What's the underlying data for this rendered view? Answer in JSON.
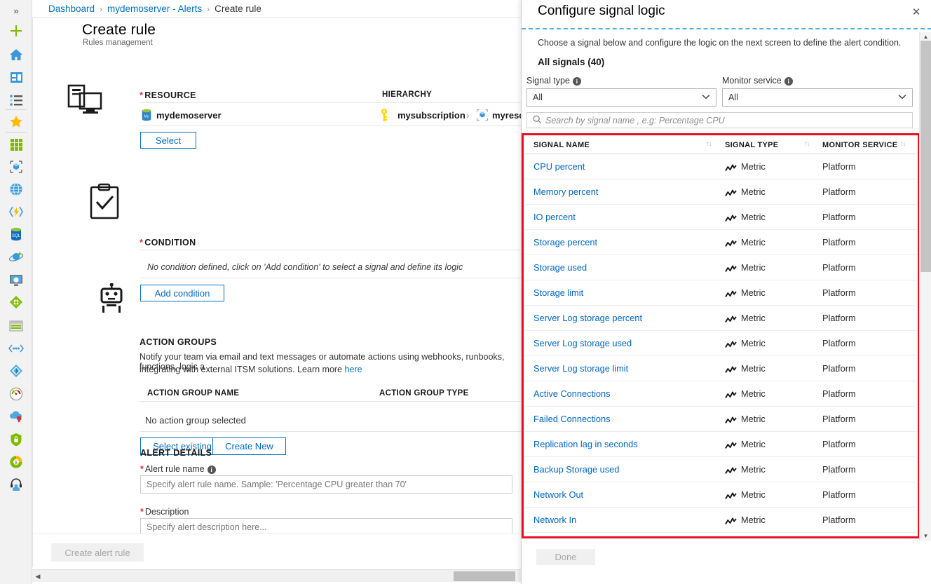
{
  "nav": {
    "collapse_label": "»",
    "items": [
      {
        "name": "create-resource-icon",
        "label": "Create a resource"
      },
      {
        "name": "home-icon",
        "label": "Home"
      },
      {
        "name": "dashboard-icon",
        "label": "Dashboard"
      },
      {
        "name": "all-services-icon",
        "label": "All services"
      },
      {
        "name": "favorites-star-icon",
        "label": "Favorites"
      },
      {
        "name": "all-resources-grid-icon",
        "label": "All resources"
      },
      {
        "name": "resource-groups-icon",
        "label": "Resource groups"
      },
      {
        "name": "app-services-icon",
        "label": "App Services"
      },
      {
        "name": "function-apps-icon",
        "label": "Function Apps"
      },
      {
        "name": "sql-databases-icon",
        "label": "SQL databases"
      },
      {
        "name": "azure-cosmos-db-icon",
        "label": "Azure Cosmos DB"
      },
      {
        "name": "virtual-machines-icon",
        "label": "Virtual machines"
      },
      {
        "name": "load-balancers-icon",
        "label": "Load balancers"
      },
      {
        "name": "storage-accounts-icon",
        "label": "Storage accounts"
      },
      {
        "name": "virtual-networks-icon",
        "label": "Virtual networks"
      },
      {
        "name": "azure-active-directory-icon",
        "label": "Azure Active Directory"
      },
      {
        "name": "monitor-icon",
        "label": "Monitor"
      },
      {
        "name": "advisor-icon",
        "label": "Advisor"
      },
      {
        "name": "security-center-icon",
        "label": "Security Center"
      },
      {
        "name": "cost-management-icon",
        "label": "Cost Management + Billing"
      },
      {
        "name": "help-and-support-icon",
        "label": "Help + support"
      }
    ]
  },
  "breadcrumb": {
    "items": [
      "Dashboard",
      "mydemoserver - Alerts",
      "Create rule"
    ],
    "separator": "›"
  },
  "blade": {
    "title": "Create rule",
    "subtitle": "Rules management",
    "resource": {
      "section_title": "RESOURCE",
      "required_mark": "*",
      "hierarchy_header": "HIERARCHY",
      "resource_name": "mydemoserver",
      "hierarchy": [
        "mysubscription",
        "myresourcegr"
      ],
      "hierarchy_sep": "›",
      "select_button": "Select"
    },
    "condition": {
      "section_title": "CONDITION",
      "required_mark": "*",
      "empty_text": "No condition defined, click on 'Add condition' to select a signal and define its logic",
      "add_button": "Add condition"
    },
    "action_groups": {
      "section_title": "ACTION GROUPS",
      "description_line1": "Notify your team via email and text messages or automate actions using webhooks, runbooks, functions, logic a",
      "description_line2": "integrating with external ITSM solutions. Learn more ",
      "learn_more_link": "here",
      "col_name": "ACTION GROUP NAME",
      "col_type": "ACTION GROUP TYPE",
      "empty_text": "No action group selected",
      "select_existing_button": "Select existing",
      "create_new_button": "Create New"
    },
    "alert_details": {
      "section_title": "ALERT DETAILS",
      "rule_name_label": "Alert rule name",
      "rule_name_required": "*",
      "rule_name_placeholder": "Specify alert rule name. Sample: 'Percentage CPU greater than 70'",
      "rule_name_value": "",
      "description_label": "Description",
      "description_required": "*",
      "description_placeholder": "Specify alert description here...",
      "description_value": ""
    },
    "footer": {
      "create_button": "Create alert rule"
    }
  },
  "panel": {
    "title": "Configure signal logic",
    "close_label": "✕",
    "description": "Choose a signal below and configure the logic on the next screen to define the alert condition.",
    "all_signals": "All signals (40)",
    "signal_type": {
      "label": "Signal type",
      "value": "All",
      "chevron": "⌄"
    },
    "monitor_service": {
      "label": "Monitor service",
      "value": "All",
      "chevron": "⌄"
    },
    "search": {
      "placeholder": "Search by signal name , e.g: Percentage CPU",
      "value": ""
    },
    "table": {
      "columns": [
        "SIGNAL NAME",
        "SIGNAL TYPE",
        "MONITOR SERVICE"
      ],
      "sort_glyph": "↑↓",
      "rows": [
        {
          "name": "CPU percent",
          "type": "Metric",
          "service": "Platform"
        },
        {
          "name": "Memory percent",
          "type": "Metric",
          "service": "Platform"
        },
        {
          "name": "IO percent",
          "type": "Metric",
          "service": "Platform"
        },
        {
          "name": "Storage percent",
          "type": "Metric",
          "service": "Platform"
        },
        {
          "name": "Storage used",
          "type": "Metric",
          "service": "Platform"
        },
        {
          "name": "Storage limit",
          "type": "Metric",
          "service": "Platform"
        },
        {
          "name": "Server Log storage percent",
          "type": "Metric",
          "service": "Platform"
        },
        {
          "name": "Server Log storage used",
          "type": "Metric",
          "service": "Platform"
        },
        {
          "name": "Server Log storage limit",
          "type": "Metric",
          "service": "Platform"
        },
        {
          "name": "Active Connections",
          "type": "Metric",
          "service": "Platform"
        },
        {
          "name": "Failed Connections",
          "type": "Metric",
          "service": "Platform"
        },
        {
          "name": "Replication lag in seconds",
          "type": "Metric",
          "service": "Platform"
        },
        {
          "name": "Backup Storage used",
          "type": "Metric",
          "service": "Platform"
        },
        {
          "name": "Network Out",
          "type": "Metric",
          "service": "Platform"
        },
        {
          "name": "Network In",
          "type": "Metric",
          "service": "Platform"
        }
      ]
    },
    "footer": {
      "done_button": "Done"
    }
  },
  "colors": {
    "accent_link": "#0066cc",
    "highlight_box": "#e81123",
    "required_star": "#d13438",
    "dashed_rule": "#4eb3e0"
  }
}
